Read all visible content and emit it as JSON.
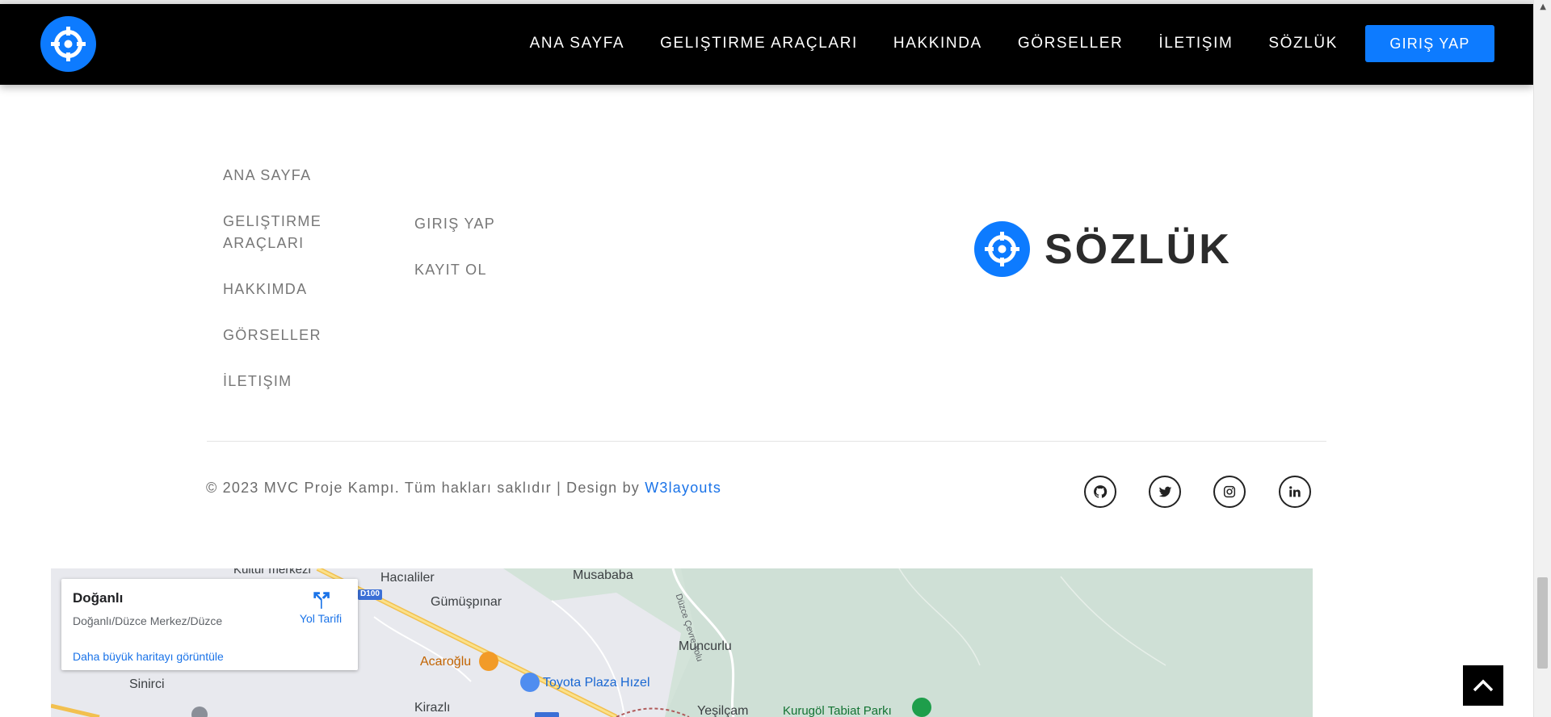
{
  "navbar": {
    "logo_icon": "crosshair-icon",
    "links": [
      "ANA SAYFA",
      "GELIŞTIRME ARAÇLARI",
      "HAKKINDA",
      "GÖRSELLER",
      "İLETIŞIM",
      "SÖZLÜK"
    ],
    "login_label": "GIRIŞ YAP"
  },
  "footer": {
    "col1": [
      "ANA SAYFA",
      "GELIŞTIRME ARAÇLARI",
      "HAKKIMDA",
      "GÖRSELLER",
      "İLETIŞIM"
    ],
    "col1_line2": "ARAÇLARI",
    "col1_line1": "GELIŞTIRME",
    "col2": [
      "GIRIŞ YAP",
      "KAYIT OL"
    ],
    "brand": "SÖZLÜK",
    "copyright_text": "© 2023 MVC Proje Kampı. Tüm hakları saklıdır | Design by ",
    "copyright_link": "W3layouts",
    "social_icons": [
      "github-icon",
      "twitter-icon",
      "instagram-icon",
      "linkedin-icon"
    ]
  },
  "map": {
    "place_title": "Doğanlı",
    "place_address": "Doğanlı/Düzce Merkez/Düzce",
    "directions_label": "Yol Tarifi",
    "larger_map_link": "Daha büyük haritayı görüntüle",
    "labels": {
      "kultur": "Kültür merkezi",
      "hacialiler": "Hacıaliler",
      "musababa": "Musababa",
      "gumuspinar": "Gümüşpınar",
      "muncurlu": "Muncurlu",
      "acaroglu": "Acaroğlu",
      "toyota": "Toyota Plaza Hızel",
      "sinirci": "Sinirci",
      "kirazli": "Kirazlı",
      "yesilcam": "Yeşilçam",
      "kurugol": "Kurugöl Tabiat Parkı",
      "cevre_yolu": "Düzce Çevre Yolu",
      "d100": "D100"
    }
  },
  "colors": {
    "accent": "#0d7bff",
    "navbar_bg": "#000000",
    "link_gray": "#777777"
  }
}
